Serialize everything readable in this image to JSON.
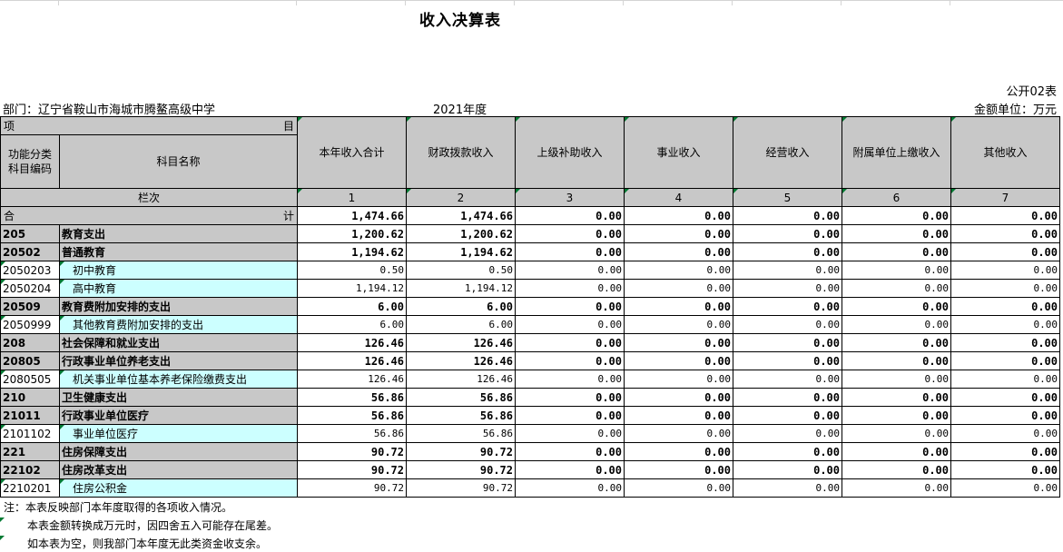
{
  "title": "收入决算表",
  "form_no": "公开02表",
  "department": "部门：辽宁省鞍山市海城市腾鳌高级中学",
  "year": "2021年度",
  "unit": "金额单位：万元",
  "header": {
    "item_left": "项",
    "item_right": "目",
    "code_col": "功能分类\n科目编码",
    "name_col": "科目名称",
    "columns": [
      "本年收入合计",
      "财政拨款收入",
      "上级补助收入",
      "事业收入",
      "经营收入",
      "附属单位上缴收入",
      "其他收入"
    ],
    "lanci": "栏次",
    "col_numbers": [
      "1",
      "2",
      "3",
      "4",
      "5",
      "6",
      "7"
    ]
  },
  "total": {
    "label_left": "合",
    "label_right": "计",
    "values": [
      "1,474.66",
      "1,474.66",
      "0.00",
      "0.00",
      "0.00",
      "0.00",
      "0.00"
    ]
  },
  "rows": [
    {
      "code": "205",
      "name": "教育支出",
      "level": "summary",
      "values": [
        "1,200.62",
        "1,200.62",
        "0.00",
        "0.00",
        "0.00",
        "0.00",
        "0.00"
      ]
    },
    {
      "code": "20502",
      "name": "普通教育",
      "level": "summary",
      "values": [
        "1,194.62",
        "1,194.62",
        "0.00",
        "0.00",
        "0.00",
        "0.00",
        "0.00"
      ]
    },
    {
      "code": "2050203",
      "name": "初中教育",
      "level": "detail",
      "values": [
        "0.50",
        "0.50",
        "0.00",
        "0.00",
        "0.00",
        "0.00",
        "0.00"
      ]
    },
    {
      "code": "2050204",
      "name": "高中教育",
      "level": "detail",
      "values": [
        "1,194.12",
        "1,194.12",
        "0.00",
        "0.00",
        "0.00",
        "0.00",
        "0.00"
      ]
    },
    {
      "code": "20509",
      "name": "教育费附加安排的支出",
      "level": "summary",
      "values": [
        "6.00",
        "6.00",
        "0.00",
        "0.00",
        "0.00",
        "0.00",
        "0.00"
      ]
    },
    {
      "code": "2050999",
      "name": "其他教育费附加安排的支出",
      "level": "detail",
      "values": [
        "6.00",
        "6.00",
        "0.00",
        "0.00",
        "0.00",
        "0.00",
        "0.00"
      ]
    },
    {
      "code": "208",
      "name": "社会保障和就业支出",
      "level": "summary",
      "values": [
        "126.46",
        "126.46",
        "0.00",
        "0.00",
        "0.00",
        "0.00",
        "0.00"
      ]
    },
    {
      "code": "20805",
      "name": "行政事业单位养老支出",
      "level": "summary",
      "values": [
        "126.46",
        "126.46",
        "0.00",
        "0.00",
        "0.00",
        "0.00",
        "0.00"
      ]
    },
    {
      "code": "2080505",
      "name": "机关事业单位基本养老保险缴费支出",
      "level": "detail",
      "values": [
        "126.46",
        "126.46",
        "0.00",
        "0.00",
        "0.00",
        "0.00",
        "0.00"
      ]
    },
    {
      "code": "210",
      "name": "卫生健康支出",
      "level": "summary",
      "values": [
        "56.86",
        "56.86",
        "0.00",
        "0.00",
        "0.00",
        "0.00",
        "0.00"
      ]
    },
    {
      "code": "21011",
      "name": "行政事业单位医疗",
      "level": "summary",
      "values": [
        "56.86",
        "56.86",
        "0.00",
        "0.00",
        "0.00",
        "0.00",
        "0.00"
      ]
    },
    {
      "code": "2101102",
      "name": "事业单位医疗",
      "level": "detail",
      "values": [
        "56.86",
        "56.86",
        "0.00",
        "0.00",
        "0.00",
        "0.00",
        "0.00"
      ]
    },
    {
      "code": "221",
      "name": "住房保障支出",
      "level": "summary",
      "values": [
        "90.72",
        "90.72",
        "0.00",
        "0.00",
        "0.00",
        "0.00",
        "0.00"
      ]
    },
    {
      "code": "22102",
      "name": "住房改革支出",
      "level": "summary",
      "values": [
        "90.72",
        "90.72",
        "0.00",
        "0.00",
        "0.00",
        "0.00",
        "0.00"
      ]
    },
    {
      "code": "2210201",
      "name": "住房公积金",
      "level": "detail",
      "values": [
        "90.72",
        "90.72",
        "0.00",
        "0.00",
        "0.00",
        "0.00",
        "0.00"
      ]
    }
  ],
  "notes": [
    "注：本表反映部门本年度取得的各项收入情况。",
    "本表金额转换成万元时，因四舍五入可能存在尾差。",
    "如本表为空，则我部门本年度无此类资金收支余。"
  ]
}
